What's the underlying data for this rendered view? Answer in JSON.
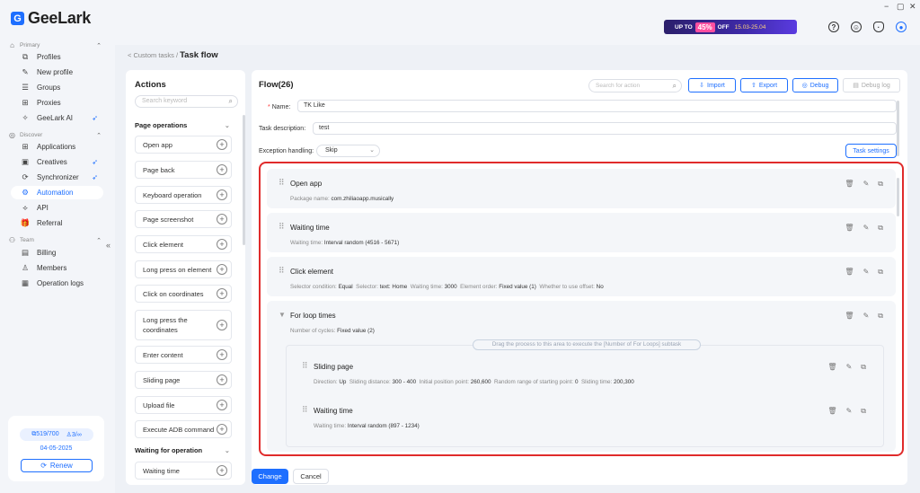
{
  "sidebar": {
    "logo": "GeeLark",
    "sections": {
      "primary": "Primary",
      "discover": "Discover",
      "team": "Team"
    },
    "primary_items": [
      {
        "label": "Profiles",
        "icon": "profiles-icon"
      },
      {
        "label": "New profile",
        "icon": "new-profile-icon"
      },
      {
        "label": "Groups",
        "icon": "groups-icon"
      },
      {
        "label": "Proxies",
        "icon": "proxies-icon"
      },
      {
        "label": "GeeLark AI",
        "icon": "ai-icon"
      }
    ],
    "discover_items": [
      {
        "label": "Applications",
        "icon": "applications-icon"
      },
      {
        "label": "Creatives",
        "icon": "creatives-icon"
      },
      {
        "label": "Synchronizer",
        "icon": "synchronizer-icon"
      },
      {
        "label": "Automation",
        "icon": "automation-icon"
      },
      {
        "label": "API",
        "icon": "api-icon"
      },
      {
        "label": "Referral",
        "icon": "referral-icon"
      }
    ],
    "team_items": [
      {
        "label": "Billing",
        "icon": "billing-icon"
      },
      {
        "label": "Members",
        "icon": "members-icon"
      },
      {
        "label": "Operation logs",
        "icon": "operation-logs-icon"
      }
    ],
    "quota": {
      "profiles": "519/700",
      "members": "3/∞",
      "date": "04-05-2025",
      "renew": "Renew"
    }
  },
  "topbar": {
    "promo": {
      "prefix": "UP TO",
      "percent": "45%",
      "suffix": "OFF",
      "dates": "15.03-25.04"
    }
  },
  "breadcrumb": {
    "parent": "< Custom tasks /",
    "current": "Task flow"
  },
  "actions_panel": {
    "title": "Actions",
    "search_placeholder": "Search keyword",
    "group1": "Page operations",
    "items": [
      "Open app",
      "Page back",
      "Keyboard operation",
      "Page screenshot",
      "Click element",
      "Long press on element",
      "Click on coordinates",
      "Long press the coordinates",
      "Enter content",
      "Sliding page",
      "Upload file",
      "Execute ADB command"
    ],
    "group2": "Waiting for operation",
    "group2_items": [
      "Waiting time"
    ]
  },
  "flow": {
    "title": "Flow(26)",
    "search_placeholder": "Search for action",
    "buttons": {
      "import": "Import",
      "export": "Export",
      "debug": "Debug",
      "debug_log": "Debug log"
    },
    "name_label": "Name:",
    "name_value": "TK Like",
    "desc_label": "Task description:",
    "desc_value": "test",
    "exception_label": "Exception handling:",
    "exception_value": "Skip",
    "task_settings": "Task settings",
    "steps": [
      {
        "title": "Open app",
        "detail": [
          [
            "Package name:",
            "com.zhiliaoapp.musically"
          ]
        ]
      },
      {
        "title": "Waiting time",
        "detail": [
          [
            "Waiting time:",
            "Interval random (4516 - 5671)"
          ]
        ]
      },
      {
        "title": "Click element",
        "detail": [
          [
            "Selector condition:",
            "Equal"
          ],
          [
            "Selector:",
            "text: Home"
          ],
          [
            "Waiting time:",
            "3000"
          ],
          [
            "Element order:",
            "Fixed value (1)"
          ],
          [
            "Whether to use offset:",
            "No"
          ]
        ]
      },
      {
        "title": "For loop times",
        "detail": [
          [
            "Number of cycles:",
            "Fixed value (2)"
          ]
        ]
      }
    ],
    "dropzone": "Drag the process to this area to execute the [Number of For Loops] subtask",
    "substeps": [
      {
        "title": "Sliding page",
        "detail": [
          [
            "Direction:",
            "Up"
          ],
          [
            "Sliding distance:",
            "300 - 400"
          ],
          [
            "Initial position point:",
            "260,600"
          ],
          [
            "Random range of starting point:",
            "0"
          ],
          [
            "Sliding time:",
            "200,300"
          ]
        ]
      },
      {
        "title": "Waiting time",
        "detail": [
          [
            "Waiting time:",
            "Interval random (897 - 1234)"
          ]
        ]
      }
    ]
  },
  "footer": {
    "change": "Change",
    "cancel": "Cancel"
  },
  "colors": {
    "accent": "#1e6fff",
    "highlight": "#e02b2b"
  }
}
